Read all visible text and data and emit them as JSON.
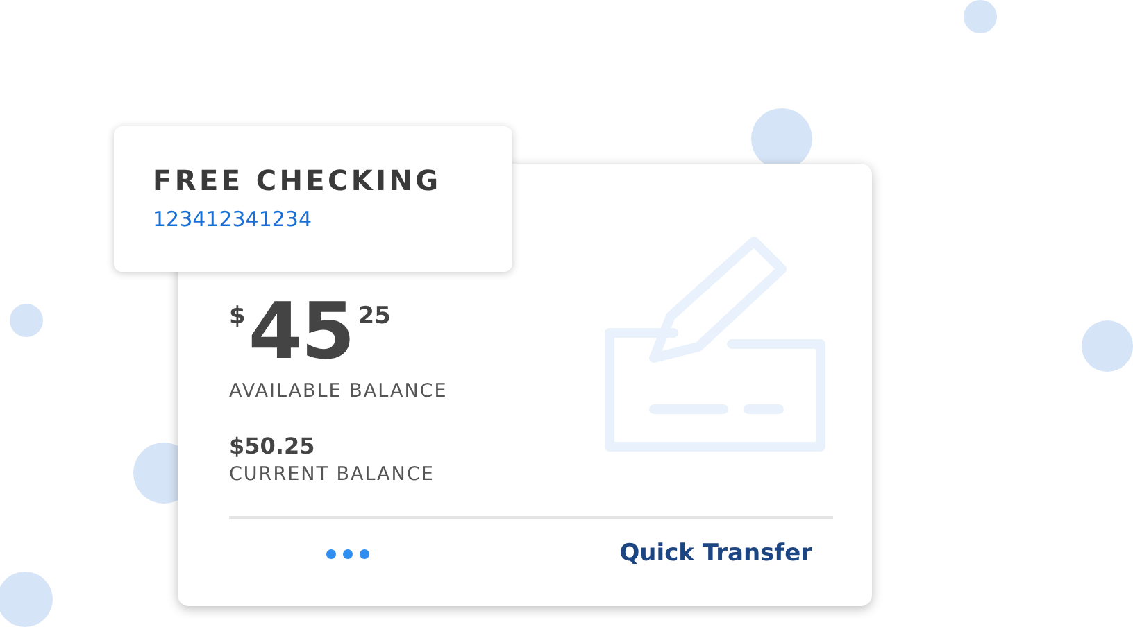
{
  "account": {
    "name": "FREE CHECKING",
    "number": "123412341234"
  },
  "available_balance": {
    "currency": "$",
    "whole": "45",
    "cents": "25",
    "label": "AVAILABLE BALANCE"
  },
  "current_balance": {
    "amount": "$50.25",
    "label": "CURRENT BALANCE"
  },
  "footer": {
    "action": "Quick Transfer"
  }
}
